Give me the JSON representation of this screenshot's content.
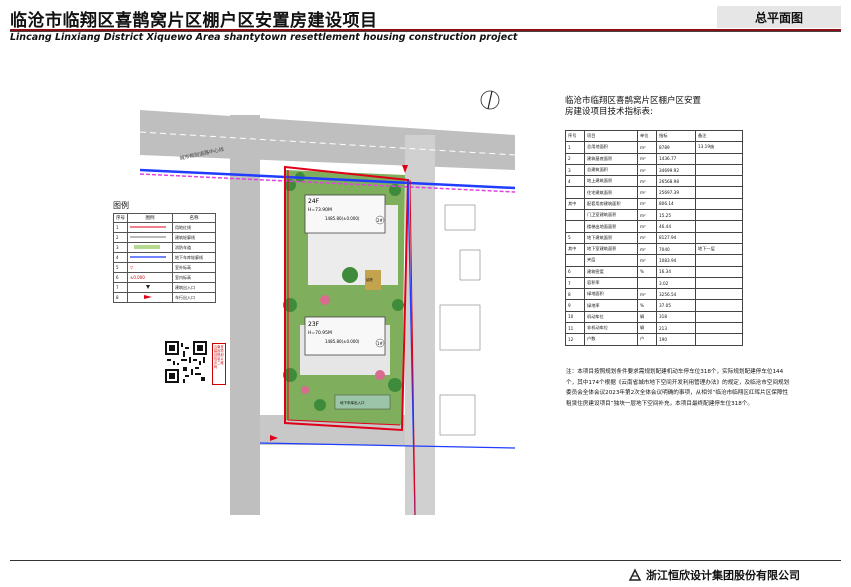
{
  "header": {
    "title": "临沧市临翔区喜鹊窝片区棚户区安置房建设项目",
    "subtitle": "Lincang Linxiang District Xiquewo Area shantytown resettlement housing construction project",
    "badge": "总平面图"
  },
  "plan": {
    "road_label": "城市规划道路中心线",
    "building1": {
      "floors": "24F",
      "height": "H=73.90M",
      "elevation": "1485.80(±0.000)",
      "units": "2#"
    },
    "building2": {
      "floors": "23F",
      "height": "H=70.95M",
      "elevation": "1485.80(±0.000)",
      "units": "1#"
    },
    "label_small": "幼托",
    "entrance_label": "地下车库出入口"
  },
  "legend": {
    "title": "图例",
    "headers": [
      "序号",
      "图例",
      "名称"
    ],
    "rows": [
      {
        "no": "1",
        "name": "用地红线"
      },
      {
        "no": "2",
        "name": "建筑轮廓线"
      },
      {
        "no": "3",
        "name": "消防车道"
      },
      {
        "no": "4",
        "name": "地下车库轮廓线"
      },
      {
        "no": "5",
        "name": "室外标高"
      },
      {
        "no": "6",
        "name": "室内标高"
      },
      {
        "no": "7",
        "name": "建筑出入口"
      },
      {
        "no": "8",
        "name": "车行出入口"
      }
    ],
    "row5_symbol": "▽",
    "row6_symbol": "±0.000"
  },
  "qr_note": "云南省建设项目规划信息公示二维码",
  "spec": {
    "title": "临沧市临翔区喜鹊窝片区棚户区安置房建设项目技术指标表:",
    "headers": [
      "序号",
      "项目",
      "单位",
      "指标",
      "备注"
    ],
    "rows": [
      {
        "no": "1",
        "item": "总用地面积",
        "unit": "m²",
        "value": "8789",
        "note": "13.19亩"
      },
      {
        "no": "2",
        "item": "建筑基底面积",
        "unit": "m²",
        "value": "1436.77",
        "note": ""
      },
      {
        "no": "3",
        "item": "总建筑面积",
        "unit": "m²",
        "value": "34699.92",
        "note": ""
      },
      {
        "no": "4",
        "item": "地上建筑面积",
        "unit": "m²",
        "value": "26568.98",
        "note": ""
      },
      {
        "no": "",
        "item": "住宅建筑面积",
        "unit": "m²",
        "value": "25697.39",
        "note": ""
      },
      {
        "no": "其中",
        "item": "配套用房建筑面积",
        "unit": "m²",
        "value": "806.14",
        "note": ""
      },
      {
        "no": "",
        "item": "门卫室建筑面积",
        "unit": "m²",
        "value": "15.25",
        "note": ""
      },
      {
        "no": "",
        "item": "楼梯出地面面积",
        "unit": "m²",
        "value": "46.44",
        "note": ""
      },
      {
        "no": "5",
        "item": "地下建筑面积",
        "unit": "m²",
        "value": "8127.94",
        "note": ""
      },
      {
        "no": "其中",
        "item": "地下室建筑面积",
        "unit": "m²",
        "value": "7040",
        "note": "地下一层"
      },
      {
        "no": "",
        "item": "夹层",
        "unit": "m²",
        "value": "1083.94",
        "note": ""
      },
      {
        "no": "6",
        "item": "建筑密度",
        "unit": "%",
        "value": "16.34",
        "note": ""
      },
      {
        "no": "7",
        "item": "容积率",
        "unit": "",
        "value": "3.02",
        "note": ""
      },
      {
        "no": "8",
        "item": "绿地面积",
        "unit": "m²",
        "value": "3256.54",
        "note": ""
      },
      {
        "no": "9",
        "item": "绿地率",
        "unit": "%",
        "value": "37.05",
        "note": ""
      },
      {
        "no": "10",
        "item": "机动车位",
        "unit": "辆",
        "value": "318",
        "note": ""
      },
      {
        "no": "11",
        "item": "非机动车位",
        "unit": "辆",
        "value": "213",
        "note": ""
      },
      {
        "no": "12",
        "item": "户数",
        "unit": "户",
        "value": "190",
        "note": ""
      }
    ]
  },
  "note": "注：本项目按照规划条件要求需规划配建机动车停车位318个，实际规划配建停车位144个，其中174个根据《云南省城市地下空间开发利用管理办法》的规定，及临沧市空间规划委员会全体会议2023年第2次全体会议明确的事项，从相邻“临沧市临翔区红晖片区保障性租赁住房建设项目”独块一层地下空间补充，本项目最终配建停车位318个。",
  "footer": {
    "company": "浙江恒欣设计集团股份有限公司"
  },
  "colors": {
    "accent": "#8b0f14",
    "red_line": "#e0001a",
    "blue_line": "#1f3cff",
    "magenta_line": "#e040e0"
  }
}
